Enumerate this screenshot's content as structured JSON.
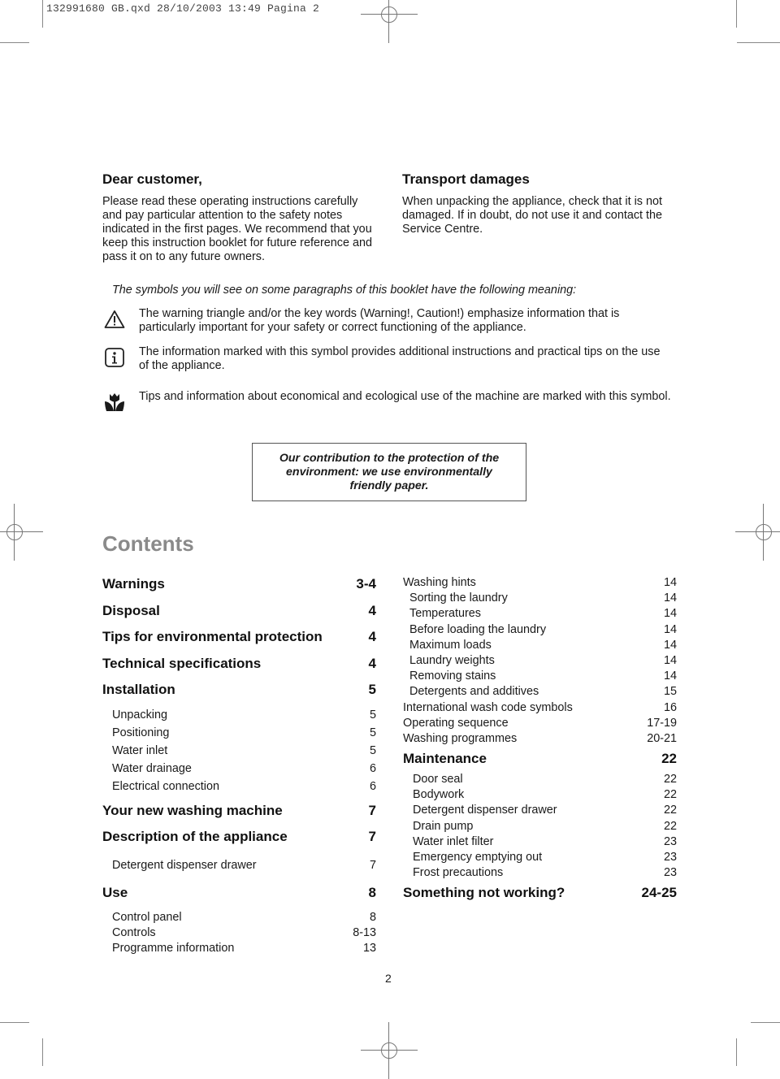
{
  "slug": "132991680 GB.qxd  28/10/2003  13:49  Pagina  2",
  "dear_customer": {
    "title": "Dear customer,",
    "lines": [
      "Please read these operating instructions carefully",
      "and pay particular attention to the safety notes",
      "indicated in the first pages. We recommend that you",
      "keep this instruction booklet for future reference and",
      "pass it on to any future owners."
    ]
  },
  "transport": {
    "title": "Transport damages",
    "lines": [
      "When unpacking the appliance, check that it is not",
      "damaged. If in doubt, do not use it and contact the",
      "Service Centre."
    ]
  },
  "symbols": {
    "intro": "The symbols you will see on some paragraphs of this booklet have the following meaning:",
    "items": [
      {
        "icon": "warning-triangle-icon",
        "lines": [
          "The warning triangle and/or the key words (Warning!, Caution!) emphasize information that is",
          "particularly important for your safety or correct functioning of the appliance."
        ]
      },
      {
        "icon": "info-icon",
        "lines": [
          "The information marked with this symbol provides additional instructions and practical tips on the use",
          "of the appliance."
        ]
      },
      {
        "icon": "eco-flower-icon",
        "lines": [
          "Tips and information about economical and ecological use of the machine are marked with this symbol."
        ]
      }
    ]
  },
  "eco_box": {
    "lines": [
      "Our contribution to the protection of the",
      "environment: we use environmentally",
      "friendly paper."
    ]
  },
  "contents": {
    "title": "Contents",
    "left": [
      {
        "level": "main",
        "title": "Warnings",
        "page": "3-4"
      },
      {
        "level": "main",
        "title": "Disposal",
        "page": "4"
      },
      {
        "level": "main",
        "title": "Tips for environmental protection",
        "page": "4"
      },
      {
        "level": "main",
        "title": "Technical specifications",
        "page": "4"
      },
      {
        "level": "main",
        "title": "Installation",
        "page": "5"
      },
      {
        "level": "sub",
        "title": "Unpacking",
        "page": "5"
      },
      {
        "level": "sub",
        "title": "Positioning",
        "page": "5"
      },
      {
        "level": "sub",
        "title": "Water inlet",
        "page": "5"
      },
      {
        "level": "sub",
        "title": "Water drainage",
        "page": "6"
      },
      {
        "level": "sub",
        "title": "Electrical connection",
        "page": "6"
      },
      {
        "level": "main",
        "title": "Your new washing machine",
        "page": "7"
      },
      {
        "level": "main",
        "title": "Description of the appliance",
        "page": "7"
      },
      {
        "level": "sub",
        "title": "Detergent dispenser drawer",
        "page": "7"
      },
      {
        "level": "main",
        "title": "Use",
        "page": "8"
      },
      {
        "level": "sub",
        "title": "Control panel",
        "page": "8"
      },
      {
        "level": "sub",
        "title": "Controls",
        "page": "8-13"
      },
      {
        "level": "sub",
        "title": "Programme information",
        "page": "13"
      }
    ],
    "right": [
      {
        "level": "mid",
        "title": "Washing hints",
        "page": "14"
      },
      {
        "level": "sub2",
        "title": "Sorting the laundry",
        "page": "14"
      },
      {
        "level": "sub2",
        "title": "Temperatures",
        "page": "14"
      },
      {
        "level": "sub2",
        "title": "Before loading the laundry",
        "page": "14"
      },
      {
        "level": "sub2",
        "title": "Maximum loads",
        "page": "14"
      },
      {
        "level": "sub2",
        "title": "Laundry weights",
        "page": "14"
      },
      {
        "level": "sub2",
        "title": "Removing stains",
        "page": "14"
      },
      {
        "level": "sub2",
        "title": "Detergents and additives",
        "page": "15"
      },
      {
        "level": "mid",
        "title": "International wash code symbols",
        "page": "16"
      },
      {
        "level": "mid",
        "title": "Operating sequence",
        "page": "17-19"
      },
      {
        "level": "mid",
        "title": "Washing programmes",
        "page": "20-21"
      },
      {
        "level": "main",
        "title": "Maintenance",
        "page": "22"
      },
      {
        "level": "sub",
        "title": "Door seal",
        "page": "22"
      },
      {
        "level": "sub",
        "title": "Bodywork",
        "page": "22"
      },
      {
        "level": "sub",
        "title": "Detergent dispenser drawer",
        "page": "22"
      },
      {
        "level": "sub",
        "title": "Drain pump",
        "page": "22"
      },
      {
        "level": "sub",
        "title": "Water inlet filter",
        "page": "23"
      },
      {
        "level": "sub",
        "title": "Emergency emptying out",
        "page": "23"
      },
      {
        "level": "sub",
        "title": "Frost precautions",
        "page": "23"
      },
      {
        "level": "main",
        "title": "Something not working?",
        "page": "24-25"
      }
    ]
  },
  "page_number": "2"
}
